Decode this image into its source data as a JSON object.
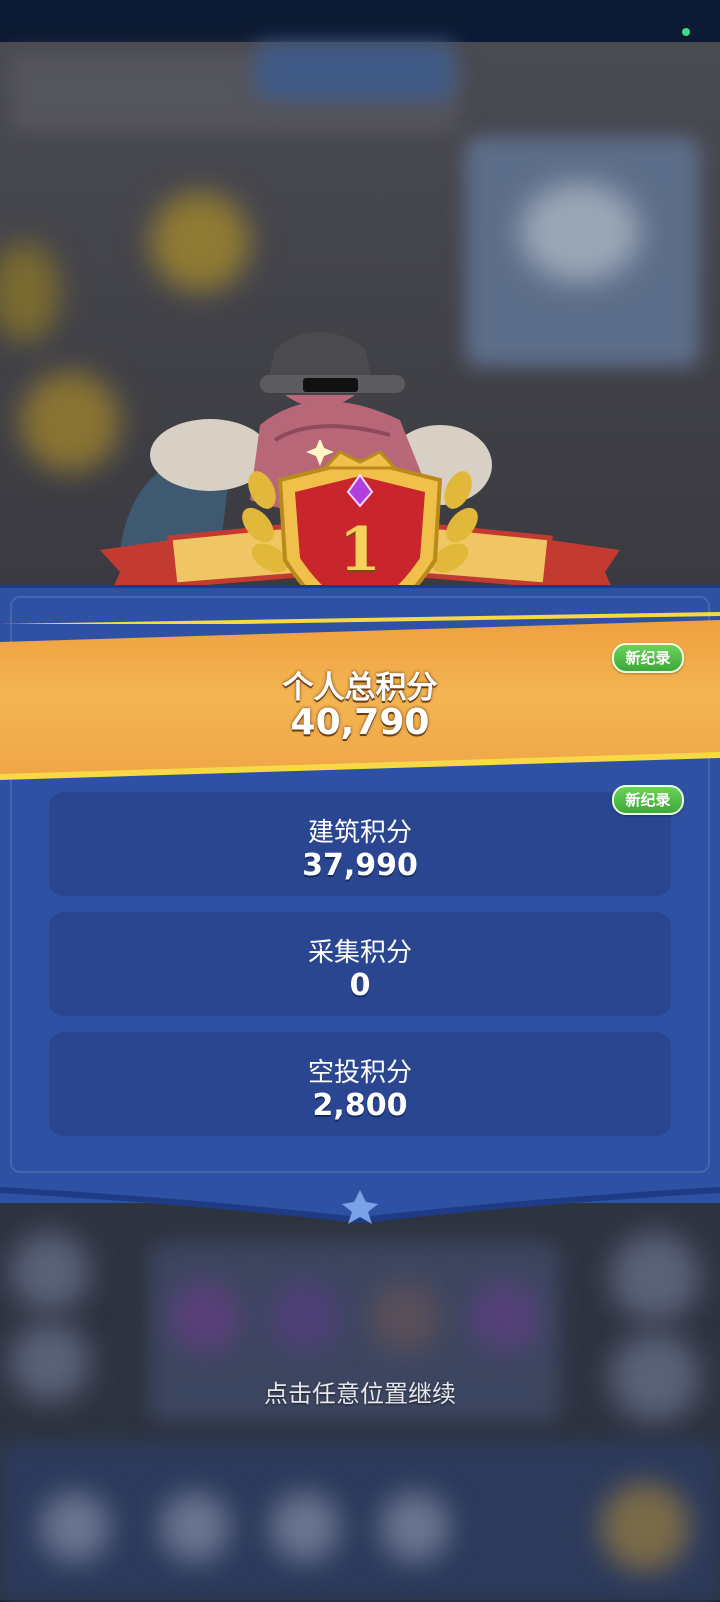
{
  "result": {
    "rank": "1",
    "total_label": "个人总积分",
    "total_value": "40,790",
    "total_badge": "新纪录"
  },
  "scores": [
    {
      "label": "建筑积分",
      "value": "37,990",
      "badge": "新纪录"
    },
    {
      "label": "采集积分",
      "value": "0",
      "badge": ""
    },
    {
      "label": "空投积分",
      "value": "2,800",
      "badge": ""
    }
  ],
  "hint": "点击任意位置继续",
  "colors": {
    "panel_blue": "#2f51a3",
    "card_blue": "#2a4691",
    "band_orange": "#f3b552",
    "badge_green": "#4fbf45"
  }
}
